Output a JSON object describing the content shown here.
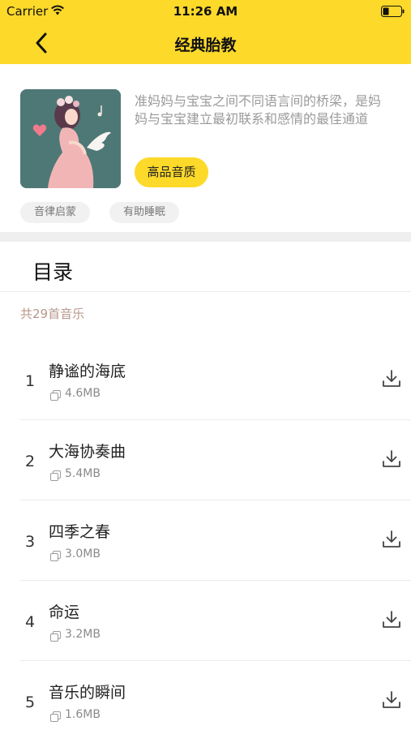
{
  "status_bar": {
    "carrier": "Carrier",
    "time": "11:26 AM"
  },
  "nav": {
    "title": "经典胎教",
    "back_icon": "chevron-left-icon"
  },
  "album": {
    "description": "准妈妈与宝宝之间不同语言间的桥梁，是妈妈与宝宝建立最初联系和感情的最佳通道",
    "quality_label": "高品音质",
    "tags": [
      "音律启蒙",
      "有助睡眠"
    ]
  },
  "catalog": {
    "title": "目录",
    "count_label": "共29首音乐",
    "tracks": [
      {
        "num": "1",
        "title": "静谧的海底",
        "size": "4.6MB"
      },
      {
        "num": "2",
        "title": "大海协奏曲",
        "size": "5.4MB"
      },
      {
        "num": "3",
        "title": "四季之春",
        "size": "3.0MB"
      },
      {
        "num": "4",
        "title": "命运",
        "size": "3.2MB"
      },
      {
        "num": "5",
        "title": "音乐的瞬间",
        "size": "1.6MB"
      }
    ]
  },
  "colors": {
    "accent": "#FDD92A",
    "divider": "#efefef",
    "muted_text": "#9a9a9a",
    "count_text": "#b8978a"
  }
}
